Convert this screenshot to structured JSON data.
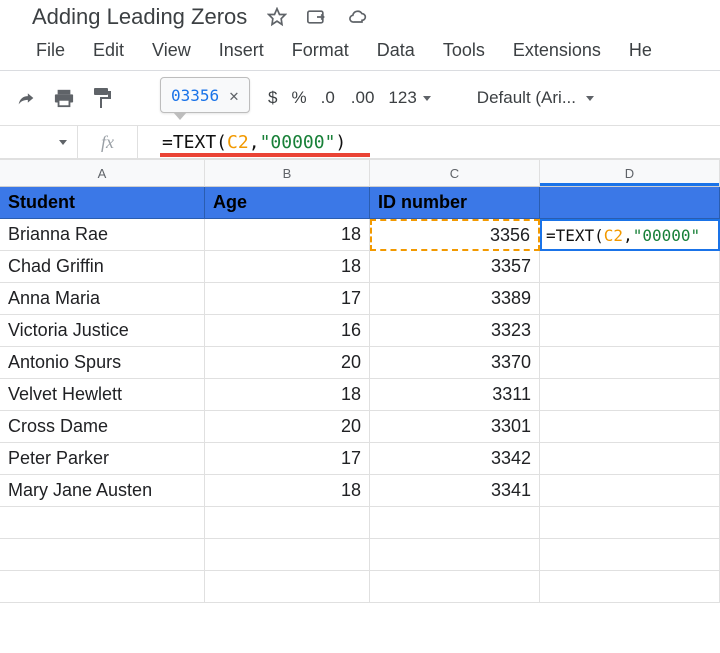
{
  "title": "Adding Leading Zeros",
  "menu": [
    "File",
    "Edit",
    "View",
    "Insert",
    "Format",
    "Data",
    "Tools",
    "Extensions",
    "He"
  ],
  "toolbar": {
    "currency": "$",
    "percent": "%",
    "dec_decrease": ".0",
    "dec_increase": ".00",
    "num_format": "123",
    "font": "Default (Ari..."
  },
  "tooltip": {
    "result": "03356"
  },
  "formula": {
    "prefix": "=TEXT(",
    "ref": "C2",
    "mid": ",",
    "str": "\"00000\"",
    "suffix": ")"
  },
  "columns": [
    "A",
    "B",
    "C",
    "D"
  ],
  "headers": {
    "A": "Student",
    "B": "Age",
    "C": "ID number",
    "D": ""
  },
  "active_formula": {
    "prefix": "=TEXT(",
    "ref": "C2",
    "mid": ",",
    "str": "\"00000\"",
    "suffix": ""
  },
  "chart_data": {
    "type": "table",
    "columns": [
      "Student",
      "Age",
      "ID number"
    ],
    "rows": [
      {
        "Student": "Brianna Rae",
        "Age": 18,
        "ID number": 3356
      },
      {
        "Student": "Chad Griffin",
        "Age": 18,
        "ID number": 3357
      },
      {
        "Student": "Anna Maria",
        "Age": 17,
        "ID number": 3389
      },
      {
        "Student": "Victoria Justice",
        "Age": 16,
        "ID number": 3323
      },
      {
        "Student": "Antonio Spurs",
        "Age": 20,
        "ID number": 3370
      },
      {
        "Student": "Velvet Hewlett",
        "Age": 18,
        "ID number": 3311
      },
      {
        "Student": "Cross Dame",
        "Age": 20,
        "ID number": 3301
      },
      {
        "Student": "Peter Parker",
        "Age": 17,
        "ID number": 3342
      },
      {
        "Student": "Mary Jane Austen",
        "Age": 18,
        "ID number": 3341
      }
    ]
  }
}
